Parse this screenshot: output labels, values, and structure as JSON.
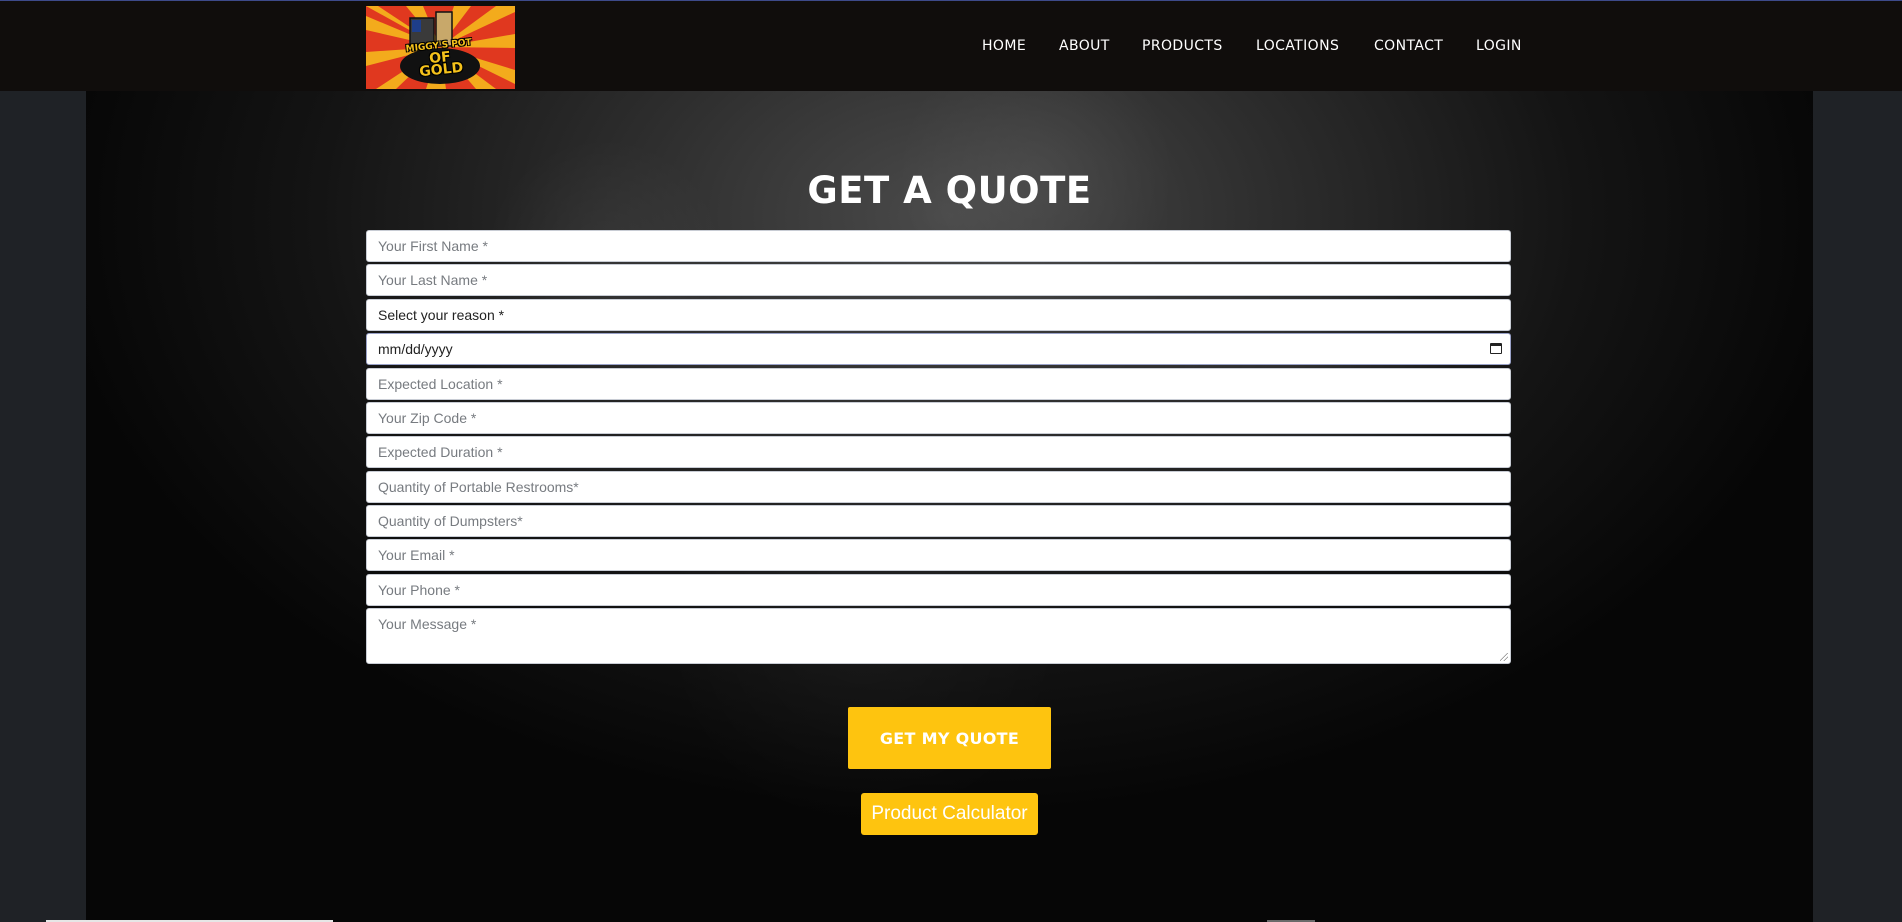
{
  "header": {
    "logo": {
      "alt": "logo",
      "line1": "MIGGY'S POT",
      "line2": "OF GOLD"
    },
    "nav": [
      {
        "label": "HOME"
      },
      {
        "label": "ABOUT"
      },
      {
        "label": "PRODUCTS"
      },
      {
        "label": "LOCATIONS"
      },
      {
        "label": "CONTACT"
      },
      {
        "label": "LOGIN"
      }
    ]
  },
  "main": {
    "title": "GET A QUOTE",
    "form": {
      "first_name": {
        "placeholder": "Your First Name *"
      },
      "last_name": {
        "placeholder": "Your Last Name *"
      },
      "reason": {
        "selected": "Select your reason *"
      },
      "date": {
        "value": "mm/dd/yyyy"
      },
      "location": {
        "placeholder": "Expected Location *"
      },
      "zip": {
        "placeholder": "Your Zip Code *"
      },
      "duration": {
        "placeholder": "Expected Duration *"
      },
      "restrooms": {
        "placeholder": "Quantity of Portable Restrooms*"
      },
      "dumpsters": {
        "placeholder": "Quantity of Dumpsters*"
      },
      "email": {
        "placeholder": "Your Email *"
      },
      "phone": {
        "placeholder": "Your Phone *"
      },
      "message": {
        "placeholder": "Your Message *"
      }
    },
    "submit_label": "GET MY QUOTE",
    "calculator_label": "Product Calculator"
  },
  "colors": {
    "header_bg": "#100d0c",
    "accent_yellow": "#fec40f",
    "logo_red": "#e0381f"
  }
}
